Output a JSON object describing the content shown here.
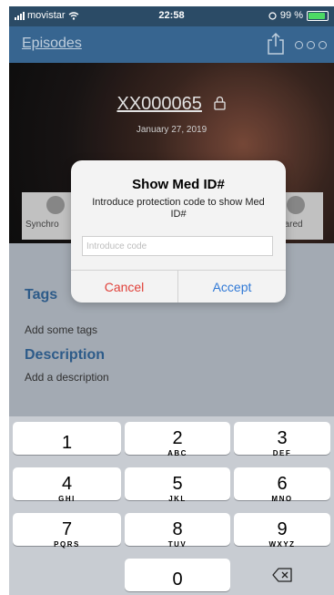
{
  "status_bar": {
    "carrier": "movistar",
    "time": "22:58",
    "battery": "99 %",
    "battery_color": "#4cd964"
  },
  "nav": {
    "back_label": "Episodes",
    "share_icon": "share-icon",
    "more_icon": "more-icon"
  },
  "hero": {
    "title": "XX000065",
    "date": "January 27, 2019",
    "sync_label": "Synchro",
    "shared_label": "hared"
  },
  "tags": {
    "heading": "Tags",
    "placeholder": "Add some tags"
  },
  "description": {
    "heading": "Description",
    "placeholder": "Add a description"
  },
  "dialog": {
    "title": "Show Med ID#",
    "message": "Introduce protection code to show Med ID#",
    "input_placeholder": "Introduce code",
    "input_value": "",
    "cancel_label": "Cancel",
    "accept_label": "Accept"
  },
  "keypad": {
    "keys": [
      {
        "num": "1",
        "letters": ""
      },
      {
        "num": "2",
        "letters": "ABC"
      },
      {
        "num": "3",
        "letters": "DEF"
      },
      {
        "num": "4",
        "letters": "GHI"
      },
      {
        "num": "5",
        "letters": "JKL"
      },
      {
        "num": "6",
        "letters": "MNO"
      },
      {
        "num": "7",
        "letters": "PQRS"
      },
      {
        "num": "8",
        "letters": "TUV"
      },
      {
        "num": "9",
        "letters": "WXYZ"
      },
      {
        "num": "0",
        "letters": ""
      }
    ],
    "delete_icon": "backspace-icon"
  },
  "colors": {
    "nav_bar": "#3a6a96",
    "accent_blue": "#2f5f8f",
    "cancel_red": "#e0413a",
    "accept_blue": "#3079d6"
  }
}
